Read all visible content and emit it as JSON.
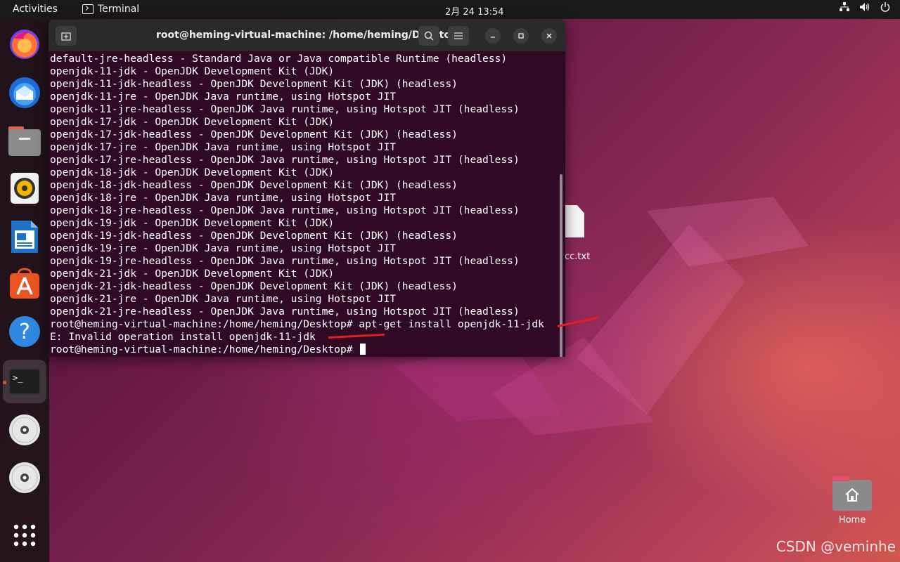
{
  "topbar": {
    "activities": "Activities",
    "app_name": "Terminal",
    "clock": "2月 24  13:54"
  },
  "dock": {
    "items": [
      {
        "name": "firefox",
        "icon": "firefox-icon"
      },
      {
        "name": "thunderbird",
        "icon": "thunderbird-icon"
      },
      {
        "name": "files",
        "icon": "files-icon"
      },
      {
        "name": "rhythmbox",
        "icon": "rhythmbox-icon"
      },
      {
        "name": "libreoffice-writer",
        "icon": "writer-icon"
      },
      {
        "name": "ubuntu-software",
        "icon": "software-icon"
      },
      {
        "name": "help",
        "icon": "help-icon"
      },
      {
        "name": "terminal",
        "icon": "terminal-icon"
      },
      {
        "name": "disc-1",
        "icon": "disc-icon"
      },
      {
        "name": "disc-2",
        "icon": "disc-icon"
      },
      {
        "name": "show-apps",
        "icon": "app-grid-icon"
      }
    ]
  },
  "terminal": {
    "title": "root@heming-virtual-machine: /home/heming/Desktop",
    "lines": [
      "default-jre-headless - Standard Java or Java compatible Runtime (headless)",
      "openjdk-11-jdk - OpenJDK Development Kit (JDK)",
      "openjdk-11-jdk-headless - OpenJDK Development Kit (JDK) (headless)",
      "openjdk-11-jre - OpenJDK Java runtime, using Hotspot JIT",
      "openjdk-11-jre-headless - OpenJDK Java runtime, using Hotspot JIT (headless)",
      "openjdk-17-jdk - OpenJDK Development Kit (JDK)",
      "openjdk-17-jdk-headless - OpenJDK Development Kit (JDK) (headless)",
      "openjdk-17-jre - OpenJDK Java runtime, using Hotspot JIT",
      "openjdk-17-jre-headless - OpenJDK Java runtime, using Hotspot JIT (headless)",
      "openjdk-18-jdk - OpenJDK Development Kit (JDK)",
      "openjdk-18-jdk-headless - OpenJDK Development Kit (JDK) (headless)",
      "openjdk-18-jre - OpenJDK Java runtime, using Hotspot JIT",
      "openjdk-18-jre-headless - OpenJDK Java runtime, using Hotspot JIT (headless)",
      "openjdk-19-jdk - OpenJDK Development Kit (JDK)",
      "openjdk-19-jdk-headless - OpenJDK Development Kit (JDK) (headless)",
      "openjdk-19-jre - OpenJDK Java runtime, using Hotspot JIT",
      "openjdk-19-jre-headless - OpenJDK Java runtime, using Hotspot JIT (headless)",
      "openjdk-21-jdk - OpenJDK Development Kit (JDK)",
      "openjdk-21-jdk-headless - OpenJDK Development Kit (JDK) (headless)",
      "openjdk-21-jre - OpenJDK Java runtime, using Hotspot JIT",
      "openjdk-21-jre-headless - OpenJDK Java runtime, using Hotspot JIT (headless)",
      "root@heming-virtual-machine:/home/heming/Desktop# apt-get install openjdk-11-jdk",
      "E: Invalid operation install openjdk-11-jdk"
    ],
    "prompt": "root@heming-virtual-machine:/home/heming/Desktop# "
  },
  "desktop": {
    "file_label": "cc.txt",
    "home_label": "Home"
  },
  "watermark": "CSDN @veminhe",
  "colors": {
    "terminal_bg": "#300a24",
    "accent": "#e95420",
    "annotation_arrow": "#e61e1e"
  }
}
